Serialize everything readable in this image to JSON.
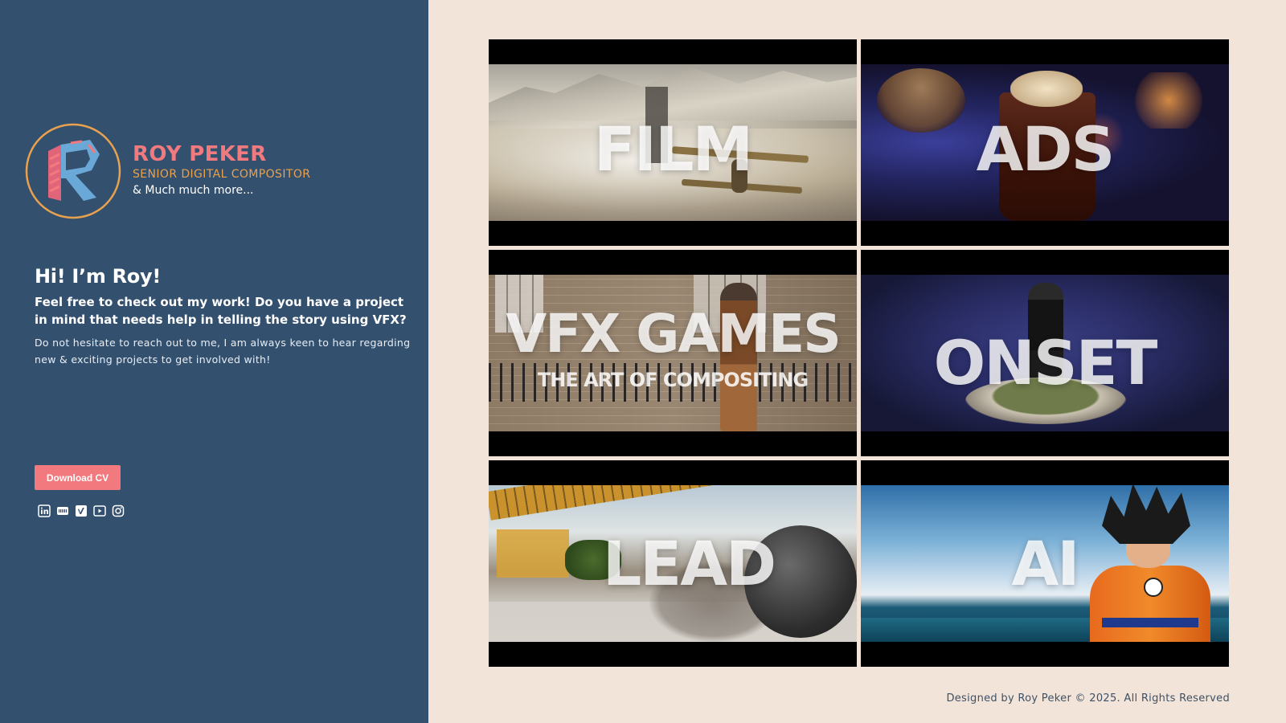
{
  "brand": {
    "name": "ROY PEKER",
    "role": "SENIOR DIGITAL COMPOSITOR",
    "tagline": "& Much much more...",
    "logo_letter": "R"
  },
  "intro": {
    "title": "Hi! I’m Roy!",
    "lead": "Feel free to check out my work! Do you have a project in mind that needs help in telling the story using VFX?",
    "body": "Do not hesitate to reach out to me, I am always keen to hear regarding new & exciting projects to get involved with!"
  },
  "cv_button": {
    "label": "Download CV"
  },
  "socials": [
    {
      "icon": "linkedin-icon"
    },
    {
      "icon": "imdb-icon"
    },
    {
      "icon": "vimeo-icon"
    },
    {
      "icon": "youtube-icon"
    },
    {
      "icon": "instagram-icon"
    }
  ],
  "tiles": [
    {
      "id": "film",
      "label": "FILM"
    },
    {
      "id": "ads",
      "label": "ADS"
    },
    {
      "id": "vfx-games",
      "label": "VFX GAMES",
      "sublabel": "THE ART OF COMPOSITING"
    },
    {
      "id": "onset",
      "label": "ONSET"
    },
    {
      "id": "lead",
      "label": "LEAD"
    },
    {
      "id": "ai",
      "label": "AI"
    }
  ],
  "footer": {
    "text": "Designed by Roy Peker © 2025. All Rights Reserved"
  },
  "colors": {
    "sidebar": "#33506f",
    "background": "#f2e4d8",
    "accent_coral": "#f27a7e",
    "accent_orange": "#e8a24f"
  }
}
